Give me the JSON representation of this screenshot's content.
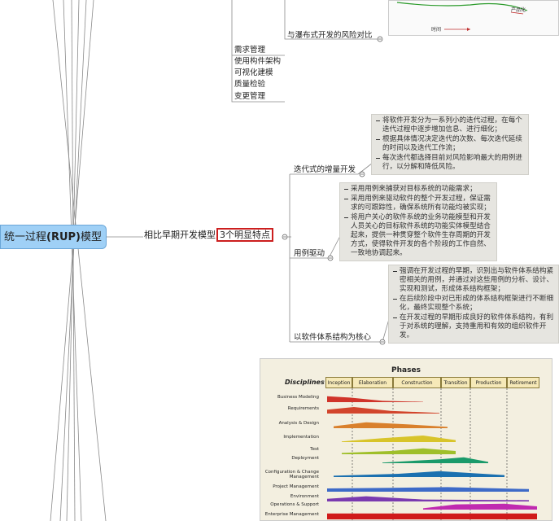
{
  "root": {
    "prefix": "统一过程",
    "bold": "(RUP)",
    "suffix": "模型"
  },
  "risk_topic": "与瀑布式开发的风险对比",
  "practices": [
    "需求管理",
    "使用构件架构",
    "可视化建模",
    "质量检验",
    "变更管理"
  ],
  "compare": {
    "label": "相比早期开发模型",
    "highlight": "3个明显特点"
  },
  "features": [
    {
      "label": "迭代式的增量开发",
      "notes": [
        "将软件开发分为一系列小的迭代过程，在每个迭代过程中逐步增加信息、进行细化；",
        "根据具体情况决定迭代的次数、每次迭代延续的时间以及迭代工作流；",
        "每次迭代都选择目前对风险影响最大的用例进行，以分解和降低风险。"
      ]
    },
    {
      "label": "用例驱动",
      "notes": [
        "采用用例来捕获对目标系统的功能需求；",
        "采用用例来驱动软件的整个开发过程，保证需求的可跟踪性，确保系统所有功能均被实现；",
        "将用户关心的软件系统的业务功能模型和开发人员关心的目标软件系统的功能实体模型结合起来，提供一种贯穿整个软件生存周期的开发方式，使得软件开发的各个阶段的工作自然、一致地协调起来。"
      ]
    },
    {
      "label": "以软件体系结构为核心",
      "notes": [
        "强调在开发过程的早期，识别出与软件体系结构紧密相关的用例，并通过对这些用例的分析、设计、实现和测试，形成体系结构框架；",
        "在后续阶段中对已形成的体系结构框架进行不断细化，最终实现整个系统；",
        "在开发过程的早期形成良好的软件体系结构，有利于对系统的理解，支持重用和有效的组织软件开发。"
      ]
    }
  ],
  "top_chart": {
    "xlabel": "时间",
    "annotation": "产品化"
  },
  "phases_chart": {
    "title": "Phases",
    "disciplines_label": "Disciplines",
    "phases": [
      "Inception",
      "Elaboration",
      "Construction",
      "Transition",
      "Production",
      "Retirement"
    ],
    "disciplines": [
      {
        "name": "Business Modeling",
        "color": "#d0342a"
      },
      {
        "name": "Requirements",
        "color": "#d2452c"
      },
      {
        "name": "Analysis & Design",
        "color": "#d9802c"
      },
      {
        "name": "Implementation",
        "color": "#d8c42a"
      },
      {
        "name": "Test",
        "color": "#9fbf2a"
      },
      {
        "name": "Deployment",
        "color": "#1a9a6a"
      },
      {
        "name": "Configuration & Change Management",
        "color": "#1a70b0"
      },
      {
        "name": "Project Management",
        "color": "#3d6ac8"
      },
      {
        "name": "Environment",
        "color": "#7a3ab0"
      },
      {
        "name": "Operations & Support",
        "color": "#c02ab0"
      },
      {
        "name": "Enterprise Management",
        "color": "#d01a1a"
      }
    ]
  }
}
